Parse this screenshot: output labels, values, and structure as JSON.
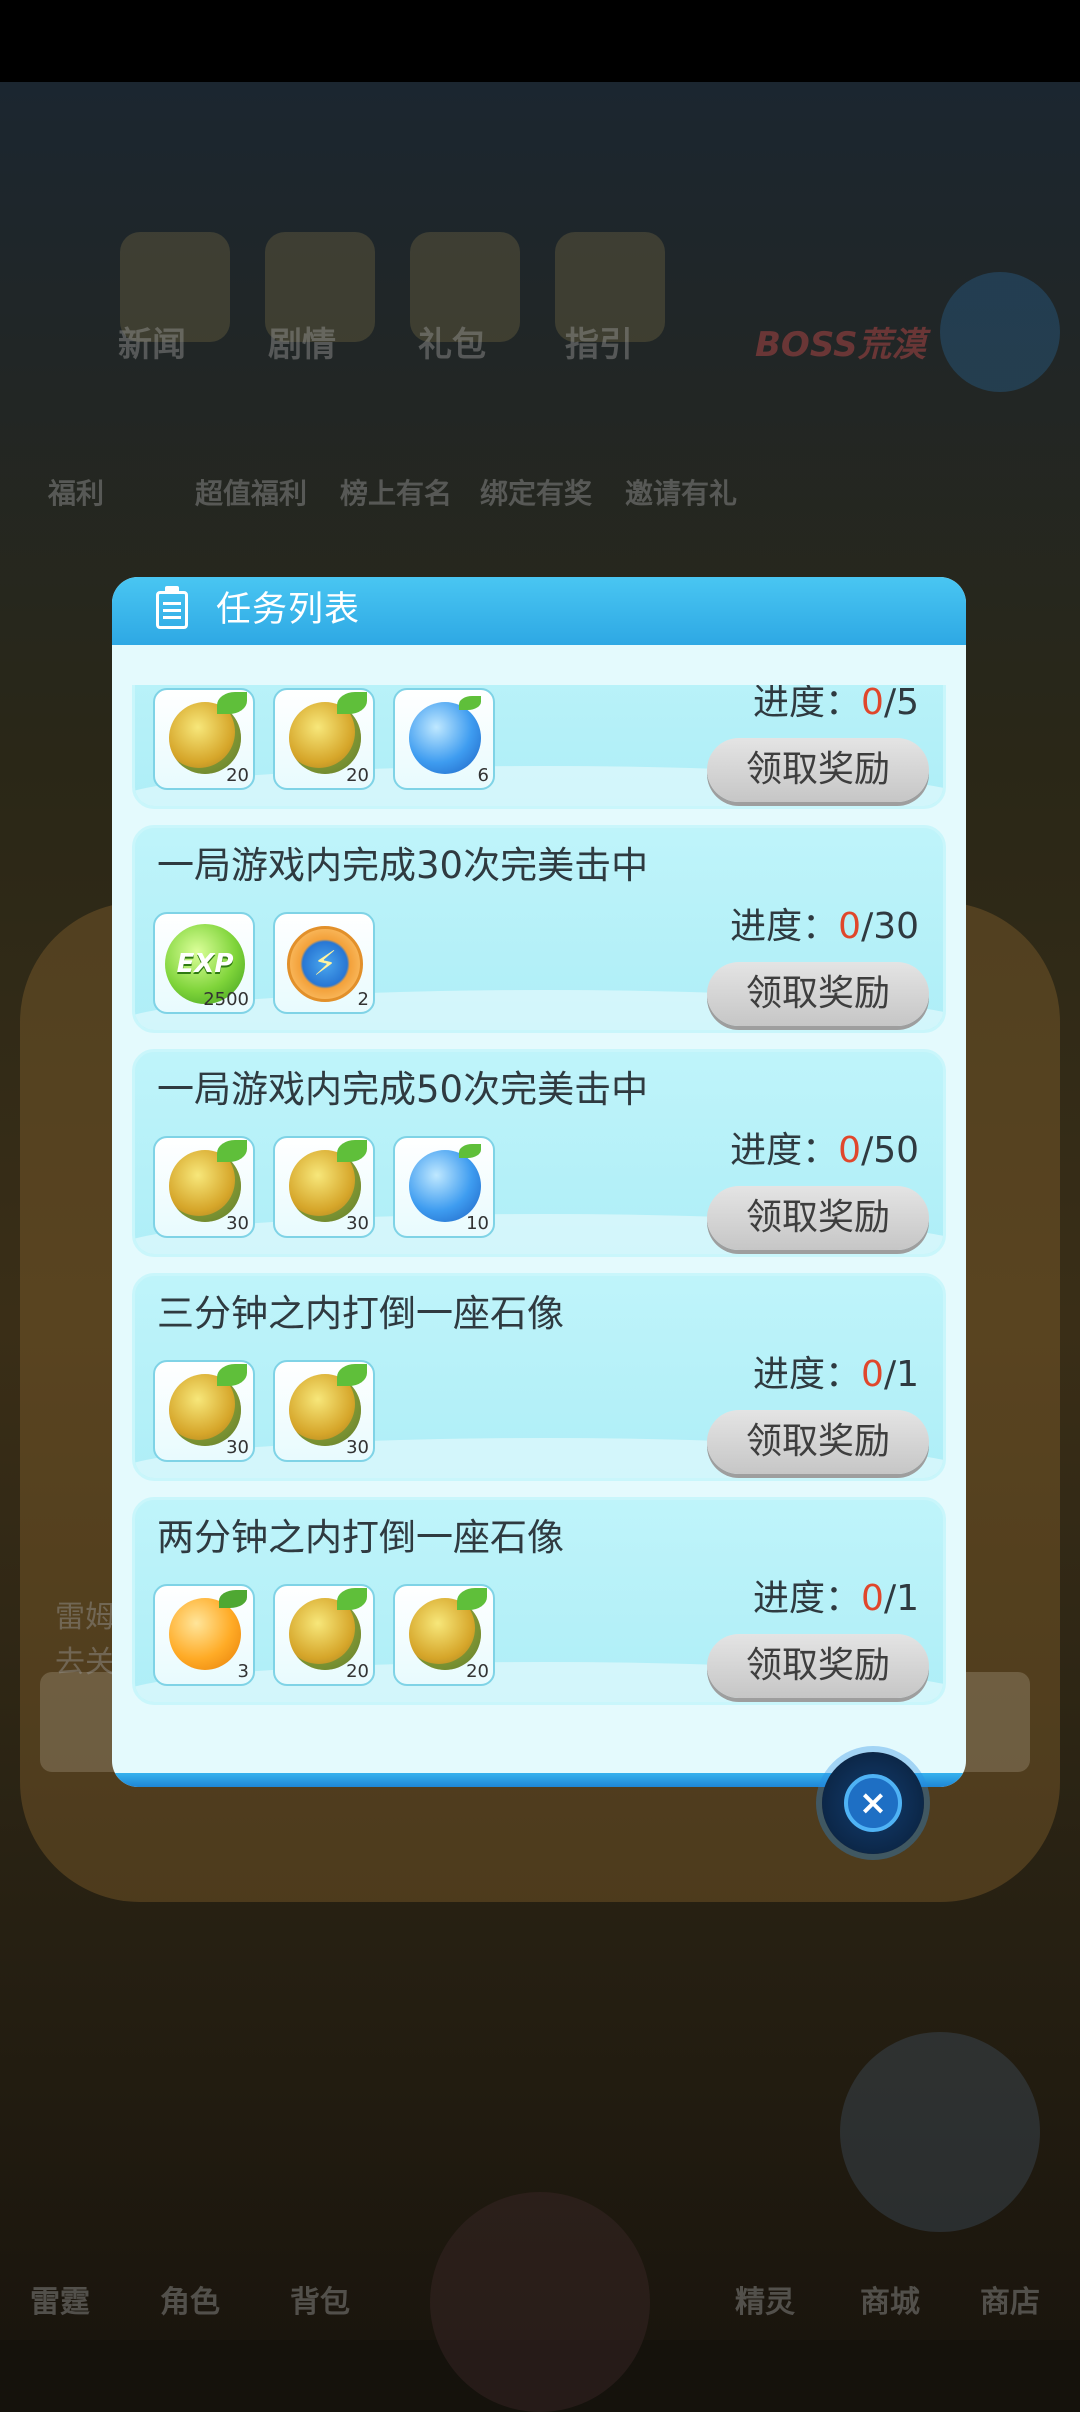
{
  "dialog": {
    "title": "任务列表",
    "header_icon": "clipboard-icon"
  },
  "tasks": [
    {
      "title": "",
      "progress_label": "进度：",
      "progress_current": "0",
      "progress_total": "/5",
      "button": "领取奖励",
      "rewards": [
        {
          "icon": "gold-fruit-icon",
          "count": "20"
        },
        {
          "icon": "gold-fruit-icon",
          "count": "20"
        },
        {
          "icon": "blue-fruit-icon",
          "count": "6"
        }
      ]
    },
    {
      "title": "一局游戏内完成30次完美击中",
      "progress_label": "进度：",
      "progress_current": "0",
      "progress_total": "/30",
      "button": "领取奖励",
      "rewards": [
        {
          "icon": "exp-orb-icon",
          "label": "EXP",
          "count": "2500"
        },
        {
          "icon": "lightning-badge-icon",
          "count": "2"
        }
      ]
    },
    {
      "title": "一局游戏内完成50次完美击中",
      "progress_label": "进度：",
      "progress_current": "0",
      "progress_total": "/50",
      "button": "领取奖励",
      "rewards": [
        {
          "icon": "gold-fruit-icon",
          "count": "30"
        },
        {
          "icon": "gold-fruit-icon",
          "count": "30"
        },
        {
          "icon": "blue-fruit-icon",
          "count": "10"
        }
      ]
    },
    {
      "title": "三分钟之内打倒一座石像",
      "progress_label": "进度：",
      "progress_current": "0",
      "progress_total": "/1",
      "button": "领取奖励",
      "rewards": [
        {
          "icon": "gold-fruit-icon",
          "count": "30"
        },
        {
          "icon": "gold-fruit-icon",
          "count": "30"
        }
      ]
    },
    {
      "title": "两分钟之内打倒一座石像",
      "progress_label": "进度：",
      "progress_current": "0",
      "progress_total": "/1",
      "button": "领取奖励",
      "rewards": [
        {
          "icon": "orange-fruit-icon",
          "count": "3"
        },
        {
          "icon": "gold-fruit-icon",
          "count": "20"
        },
        {
          "icon": "gold-fruit-icon",
          "count": "20"
        }
      ]
    }
  ],
  "background": {
    "top_menu": [
      "新闻",
      "剧情",
      "礼包",
      "指引",
      "BOSS荒漠"
    ],
    "second_menu": [
      "福利",
      "超值福利",
      "榜上有名",
      "绑定有奖",
      "邀请有礼"
    ],
    "bottom_nav": [
      "雷霆",
      "角色",
      "背包",
      "精灵",
      "商城",
      "商店"
    ],
    "field_text": [
      "雷姆",
      "去关"
    ],
    "task_button": "任务列表"
  }
}
